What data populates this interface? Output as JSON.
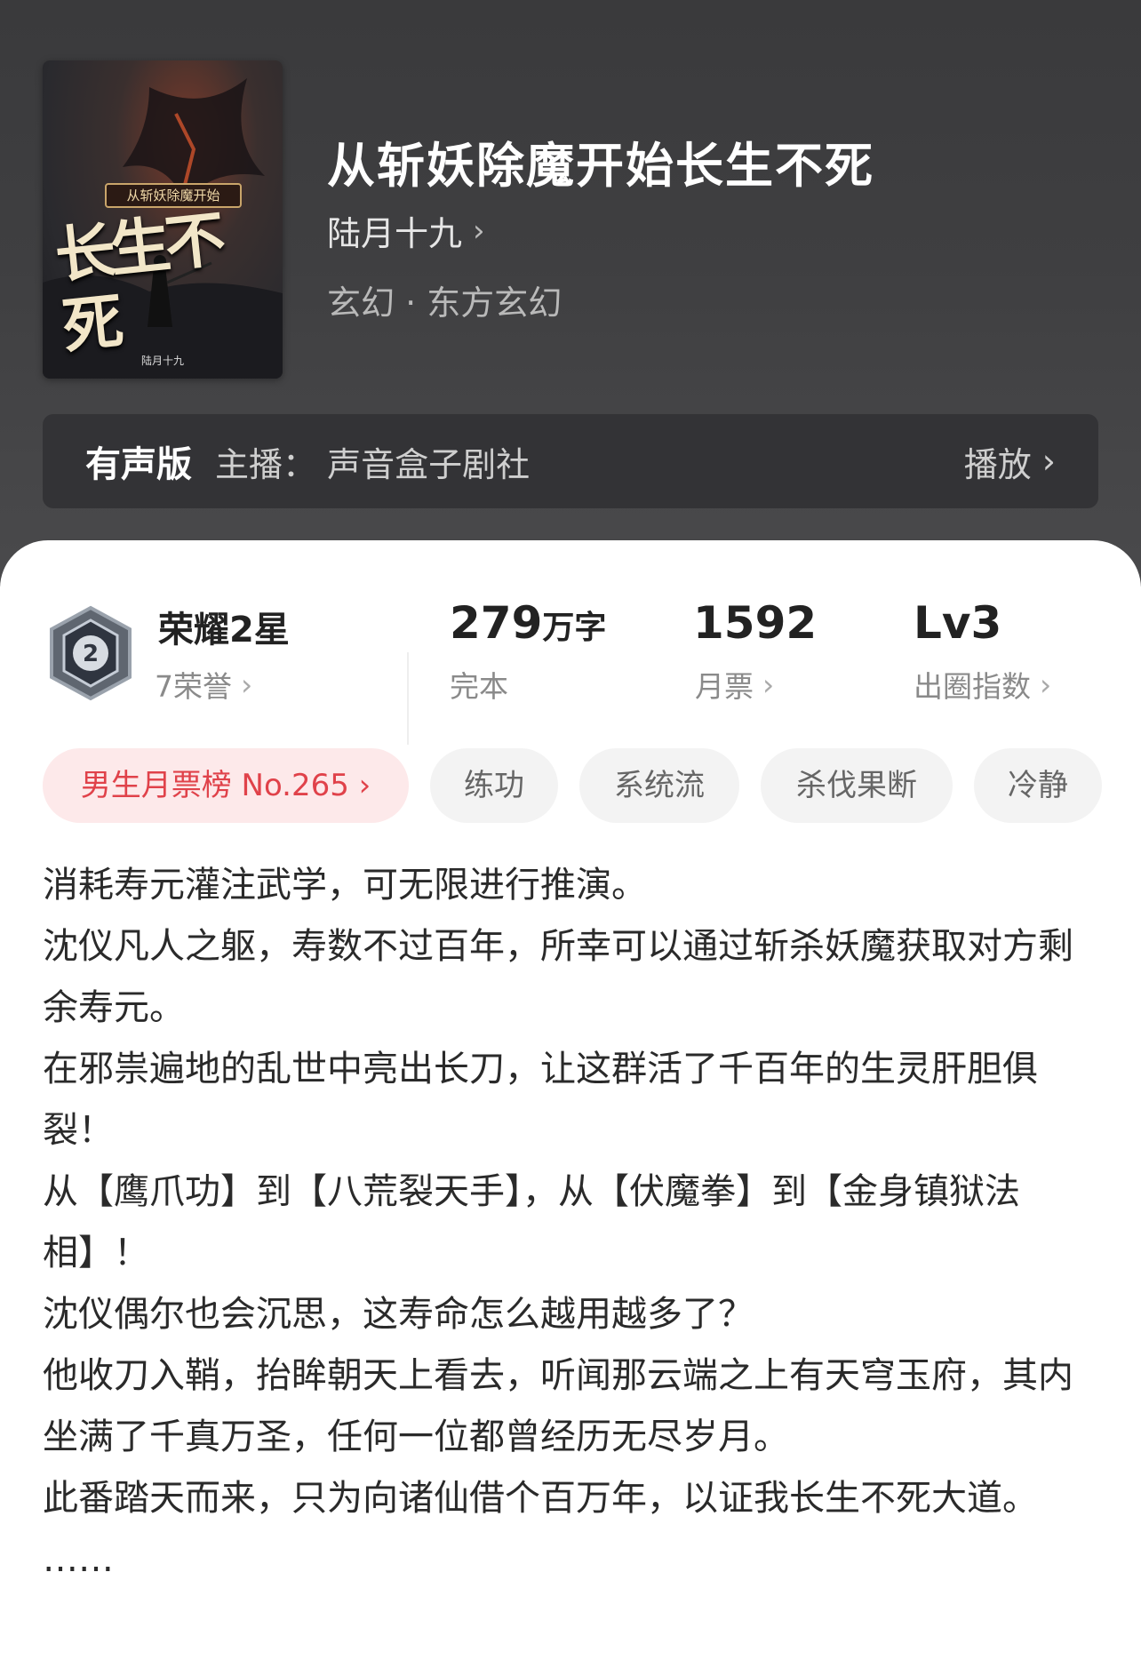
{
  "book": {
    "title": "从斩妖除魔开始长生不死",
    "author": "陆月十九",
    "genre": "玄幻 · 东方玄幻",
    "cover": {
      "subtitle": "从斩妖除魔开始",
      "big_title": "长生不死",
      "author": "陆月十九"
    }
  },
  "audio": {
    "label": "有声版",
    "narrator": "主播：  声音盒子剧社",
    "play_label": "播放"
  },
  "stats": {
    "honor": {
      "title": "荣耀2星",
      "sub": "7荣誉",
      "badge_number": "2"
    },
    "words": {
      "value": "279",
      "unit": "万字",
      "sub": "完本"
    },
    "monthly": {
      "value": "1592",
      "sub": "月票"
    },
    "circle": {
      "value": "Lv3",
      "sub": "出圈指数"
    }
  },
  "tags": {
    "rank": "男生月票榜 No.265",
    "items": [
      "练功",
      "系统流",
      "杀伐果断",
      "冷静"
    ]
  },
  "synopsis": [
    "消耗寿元灌注武学，可无限进行推演。",
    "沈仪凡人之躯，寿数不过百年，所幸可以通过斩杀妖魔获取对方剩余寿元。",
    "在邪祟遍地的乱世中亮出长刀，让这群活了千百年的生灵肝胆俱裂！",
    "从【鹰爪功】到【八荒裂天手】，从【伏魔拳】到【金身镇狱法相】！",
    "沈仪偶尔也会沉思，这寿命怎么越用越多了？",
    "他收刀入鞘，抬眸朝天上看去，听闻那云端之上有天穹玉府，其内坐满了千真万圣，任何一位都曾经历无尽岁月。",
    "此番踏天而来，只为向诸仙借个百万年，以证我长生不死大道。",
    "……"
  ],
  "icons": {
    "chevron": "chevron-right-icon",
    "badge": "honor-badge-icon"
  },
  "colors": {
    "header_bg": "#3f3f41",
    "rank_tag_bg": "#fde9ea",
    "rank_tag_text": "#e0424a"
  }
}
